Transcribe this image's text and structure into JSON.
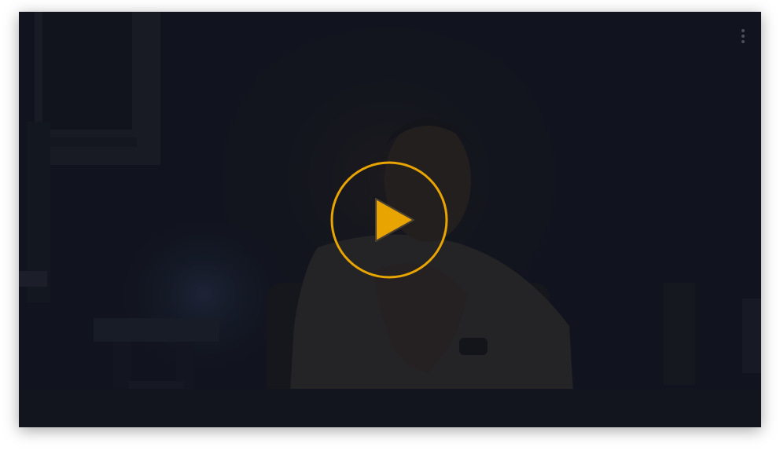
{
  "player": {
    "state": "paused",
    "accent_color": "#e8a400",
    "background_color": "#141720"
  },
  "controls": {
    "play_icon": "play-icon",
    "menu_icon": "more-vertical-icon"
  }
}
